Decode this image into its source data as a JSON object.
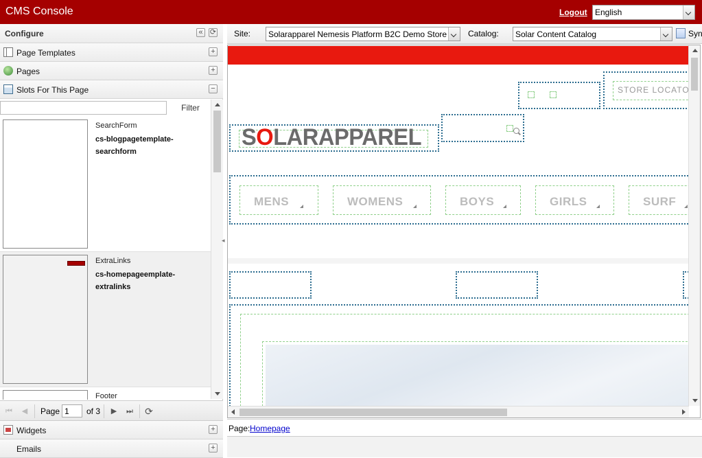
{
  "header": {
    "title": "CMS Console",
    "logout": "Logout",
    "language": "English"
  },
  "left_panel": {
    "configure_title": "Configure",
    "sections": {
      "page_templates": "Page Templates",
      "pages": "Pages",
      "slots": "Slots For This Page",
      "widgets": "Widgets",
      "emails": "Emails"
    },
    "filter": {
      "value": "",
      "button": "Filter"
    },
    "slots": [
      {
        "name": "SearchForm",
        "id": "cs-blogpagetemplate-searchform"
      },
      {
        "name": "ExtraLinks",
        "id": "cs-homepageemplate-extralinks"
      },
      {
        "name": "Footer",
        "id": ""
      }
    ],
    "pager": {
      "label": "Page",
      "current": "1",
      "of": "of 3"
    }
  },
  "toolbar": {
    "site_label": "Site:",
    "site_value": "Solarapparel Nemesis Platform B2C Demo Store",
    "catalog_label": "Catalog:",
    "catalog_value": "Solar Content Catalog",
    "sync_label": "Sync"
  },
  "preview": {
    "logo": {
      "pre": "S",
      "o": "O",
      "post": "LARAPPAREL"
    },
    "store_locator": "STORE LOCATOR",
    "nav": [
      "MENS",
      "WOMENS",
      "BOYS",
      "GIRLS",
      "SURF"
    ]
  },
  "footer": {
    "page_label": "Page:",
    "page_link": "Homepage"
  },
  "colors": {
    "header_bg": "#a50000",
    "accent_red": "#e8190f",
    "slot_border": "#2b6c8f",
    "component_border": "#8fd08a"
  }
}
